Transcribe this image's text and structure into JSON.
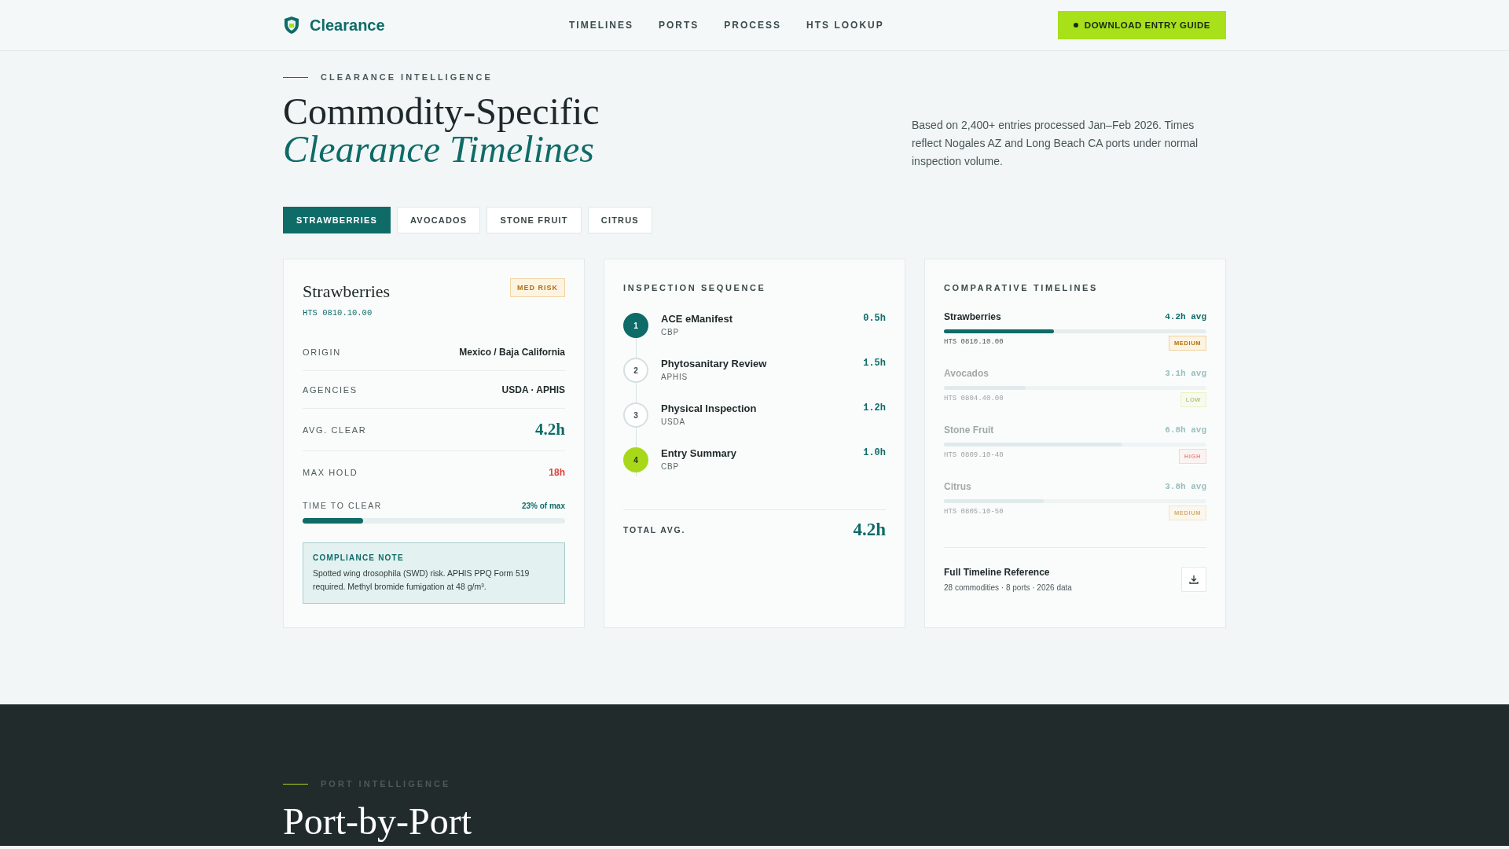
{
  "header": {
    "logo": "Clearance",
    "nav": [
      {
        "label": "TIMELINES"
      },
      {
        "label": "PORTS"
      },
      {
        "label": "PROCESS"
      },
      {
        "label": "HTS LOOKUP"
      }
    ],
    "cta": "DOWNLOAD ENTRY GUIDE"
  },
  "hero": {
    "eyebrow": "CLEARANCE INTELLIGENCE",
    "title": "Commodity-Specific",
    "title_accent": "Clearance Timelines",
    "description": "Based on 2,400+ entries processed Jan–Feb 2026. Times reflect Nogales AZ and Long Beach CA ports under normal inspection volume."
  },
  "tabs": [
    {
      "label": "STRAWBERRIES",
      "selected": true
    },
    {
      "label": "AVOCADOS",
      "selected": false
    },
    {
      "label": "STONE FRUIT",
      "selected": false
    },
    {
      "label": "CITRUS",
      "selected": false
    }
  ],
  "commodity": {
    "name": "Strawberries",
    "hts": "HTS 0810.10.00",
    "risk_badge": {
      "label": "MED RISK",
      "kind": "medium"
    },
    "facts": [
      {
        "label": "ORIGIN",
        "value": "Mexico / Baja California",
        "kind": "text"
      },
      {
        "label": "AGENCIES",
        "value": "USDA · APHIS",
        "kind": "text"
      },
      {
        "label": "AVG. CLEAR",
        "value": "4.2h",
        "kind": "highlight"
      },
      {
        "label": "MAX HOLD",
        "value": "18h",
        "kind": "alert"
      }
    ],
    "time_to_clear": {
      "label": "TIME TO CLEAR",
      "reading": "23% of max",
      "level": 0.23
    },
    "note": {
      "title": "COMPLIANCE NOTE",
      "text": "Spotted wing drosophila (SWD) risk. APHIS PPQ Form 519 required. Methyl bromide fumigation at 48 g/m³."
    }
  },
  "sequence": {
    "title": "INSPECTION SEQUENCE",
    "steps": [
      {
        "number": "1",
        "name": "ACE eManifest",
        "agency": "CBP",
        "duration": "0.5h",
        "kind": "active"
      },
      {
        "number": "2",
        "name": "Phytosanitary Review",
        "agency": "APHIS",
        "duration": "1.5h",
        "kind": "pending"
      },
      {
        "number": "3",
        "name": "Physical Inspection",
        "agency": "USDA",
        "duration": "1.2h",
        "kind": "pending"
      },
      {
        "number": "4",
        "name": "Entry Summary",
        "agency": "CBP",
        "duration": "1.0h",
        "kind": "final"
      }
    ],
    "total_label": "TOTAL AVG.",
    "total": "4.2h"
  },
  "comparative": {
    "title": "COMPARATIVE TIMELINES",
    "items": [
      {
        "name": "Strawberries",
        "avg": "4.2h avg",
        "hts": "HTS 0810.10.00",
        "risk": {
          "label": "MEDIUM",
          "kind": "medium"
        },
        "level": 0.42,
        "selected": true
      },
      {
        "name": "Avocados",
        "avg": "3.1h avg",
        "hts": "HTS 0804.40.00",
        "risk": {
          "label": "LOW",
          "kind": "low"
        },
        "level": 0.31,
        "selected": false
      },
      {
        "name": "Stone Fruit",
        "avg": "6.8h avg",
        "hts": "HTS 0809.10-40",
        "risk": {
          "label": "HIGH",
          "kind": "high"
        },
        "level": 0.68,
        "selected": false
      },
      {
        "name": "Citrus",
        "avg": "3.8h avg",
        "hts": "HTS 0805.10-50",
        "risk": {
          "label": "MEDIUM",
          "kind": "medium"
        },
        "level": 0.38,
        "selected": false
      }
    ],
    "reference": {
      "title": "Full Timeline Reference",
      "meta": "28 commodities · 8 ports · 2026 data"
    }
  },
  "ports": {
    "eyebrow": "PORT INTELLIGENCE",
    "title": "Port-by-Port"
  }
}
